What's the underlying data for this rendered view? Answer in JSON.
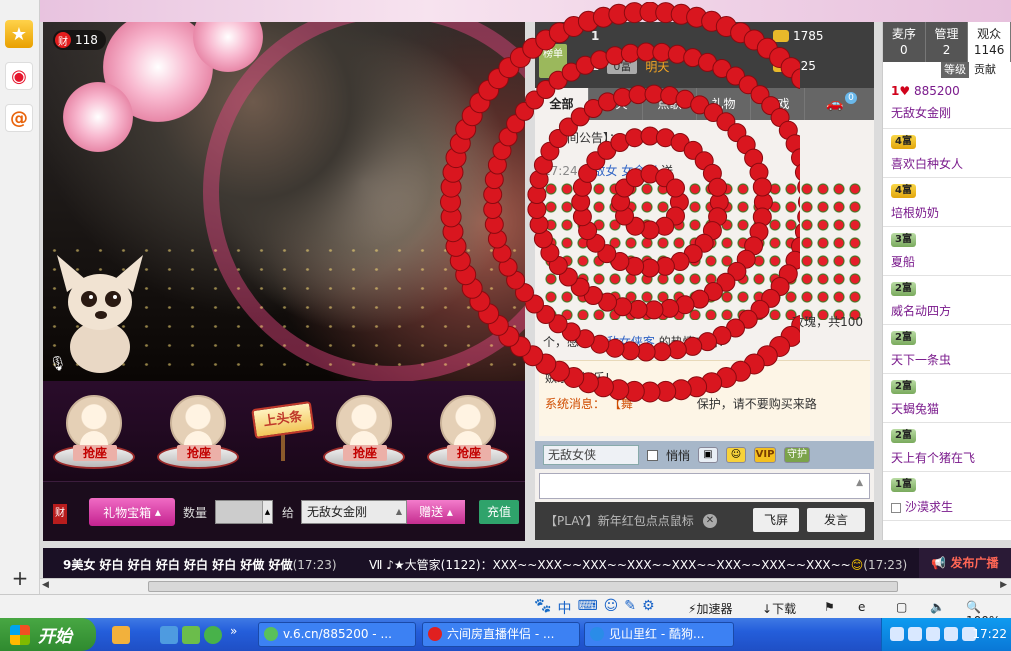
{
  "browser": {
    "sidebar_icons": [
      "star-icon",
      "weibo-icon",
      "at-icon"
    ],
    "add_label": "+"
  },
  "video": {
    "wealth_badge": "财",
    "wealth_count": "118"
  },
  "seats": {
    "grab_label": "抢座",
    "headline_label": "上头条"
  },
  "giftbar": {
    "cai_label": "财",
    "gift_box_label": "礼物宝箱",
    "qty_label": "数量",
    "to_label": "给",
    "recipient": "无敌女金刚",
    "send_label": "赠送",
    "charge_label": "充值"
  },
  "top_fans": {
    "tag": "榜单",
    "rows": [
      {
        "rank": "1",
        "badge": "",
        "name": "",
        "coins": "1785"
      },
      {
        "rank": "2",
        "badge": "0富",
        "name": "明天",
        "coins": "125"
      }
    ]
  },
  "chat": {
    "tabs": [
      "全部",
      "聊天",
      "点歌",
      "礼物",
      "游戏"
    ],
    "car_count": "0",
    "notice_label": "【房间公告】：",
    "msg_time": "17:24",
    "msg_user": "无敌女",
    "msg_target": "女金刚",
    "msg_verb": "送",
    "thanks_pre": "玫瑰，共100",
    "thanks_mid": "个，感谢",
    "thanks_user": "无敌女侠客",
    "thanks_post": "的热情支持!",
    "sys_line1": "嫉系统娱乐!",
    "sys_label": "系统消息",
    "sys_text": "【舞",
    "sys_tail": "保护，请不要购买来路",
    "to_select": "无敌女侠",
    "private_label": "悄悄",
    "vip_label": "VIP",
    "guard_label": "守护",
    "play_text": "【PLAY】新年红包点点鼠标",
    "fly_label": "飞屏",
    "send_label": "发言"
  },
  "audience": {
    "tabs": [
      {
        "label": "麦序",
        "count": "0"
      },
      {
        "label": "管理",
        "count": "2"
      },
      {
        "label": "观众",
        "count": "1146"
      }
    ],
    "sub_tabs": [
      "等级",
      "贡献"
    ],
    "items": [
      {
        "level": "1",
        "value": "885200",
        "name": "无敌女金刚"
      },
      {
        "level": "4富",
        "value": "",
        "name": "喜欢白种女人"
      },
      {
        "level": "4富",
        "value": "",
        "name": "培根奶奶"
      },
      {
        "level": "3富",
        "value": "",
        "name": "夏船"
      },
      {
        "level": "2富",
        "value": "",
        "name": "威名动四方"
      },
      {
        "level": "2富",
        "value": "",
        "name": "天下一条虫"
      },
      {
        "level": "2富",
        "value": "",
        "name": "天蝎兔猫"
      },
      {
        "level": "2富",
        "value": "",
        "name": "天上有个猪在飞"
      },
      {
        "level": "1富",
        "value": "",
        "name": "沙漠求生"
      }
    ]
  },
  "marquee": {
    "left_text": "9美女 好白 好白 好白 好白 好白 好做 好做",
    "left_time": "(17:23)",
    "right_text": "Ⅶ ♪★大管家(1122)：XXX~~XXX~~XXX~~XXX~~XXX~~XXX~~XXX~~XXX~~",
    "right_time": "(17:23)",
    "broadcast_label": "发布广播"
  },
  "statusbar": {
    "ime_icons": [
      "paw-icon",
      "zh-icon",
      "keyboard-icon",
      "smile-icon",
      "pen-icon",
      "gear-icon"
    ],
    "zh_label": "中",
    "accelerator": "加速器",
    "download": "下载",
    "zoom": "100%"
  },
  "taskbar": {
    "start_label": "开始",
    "tasks": [
      "v.6.cn/885200 - ...",
      "六间房直播伴侣 - ...",
      "见山里红 - 酷狗..."
    ],
    "more_label": "»",
    "clock": "17:22"
  },
  "colors": {
    "accent_pink": "#e0439c",
    "chat_link": "#3064c5",
    "audience_name": "#7a1a8c",
    "taskbar_blue": "#245edb"
  }
}
